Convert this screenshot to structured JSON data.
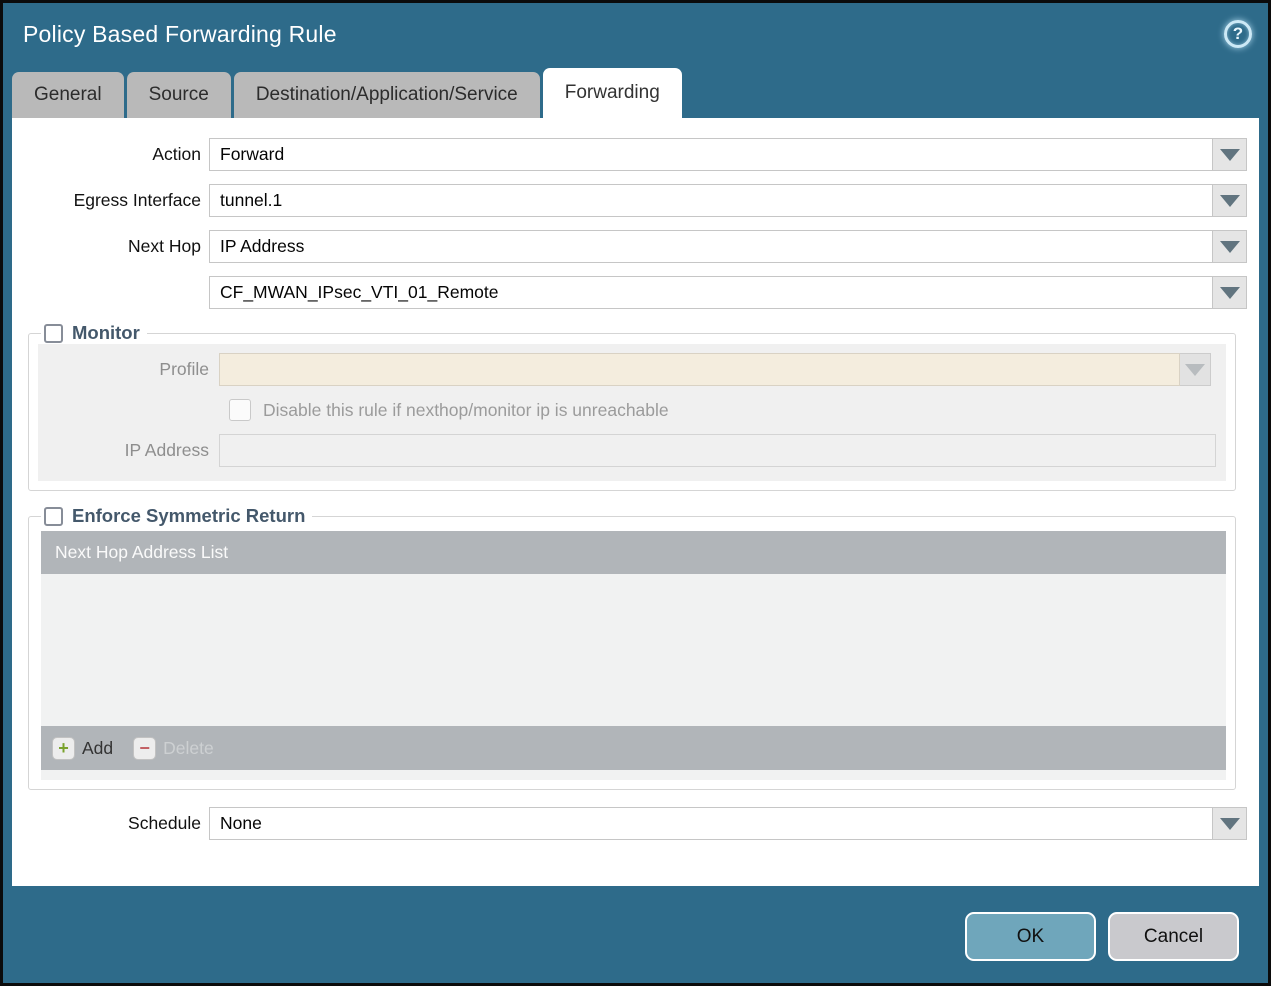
{
  "dialog": {
    "title": "Policy Based Forwarding Rule"
  },
  "tabs": [
    {
      "label": "General",
      "active": false
    },
    {
      "label": "Source",
      "active": false
    },
    {
      "label": "Destination/Application/Service",
      "active": false
    },
    {
      "label": "Forwarding",
      "active": true
    }
  ],
  "form": {
    "action": {
      "label": "Action",
      "value": "Forward"
    },
    "egress_interface": {
      "label": "Egress Interface",
      "value": "tunnel.1"
    },
    "next_hop": {
      "label": "Next Hop",
      "value": "IP Address"
    },
    "next_hop_address": {
      "value": "CF_MWAN_IPsec_VTI_01_Remote"
    },
    "schedule": {
      "label": "Schedule",
      "value": "None"
    }
  },
  "monitor": {
    "legend": "Monitor",
    "checked": false,
    "profile": {
      "label": "Profile",
      "value": ""
    },
    "disable_rule": {
      "label": "Disable this rule if nexthop/monitor ip is unreachable",
      "checked": false
    },
    "ip_address": {
      "label": "IP Address",
      "value": ""
    }
  },
  "symmetric_return": {
    "legend": "Enforce Symmetric Return",
    "checked": false,
    "table": {
      "header": "Next Hop Address List",
      "rows": [],
      "add_label": "Add",
      "delete_label": "Delete"
    }
  },
  "footer": {
    "ok_label": "OK",
    "cancel_label": "Cancel"
  },
  "icons": {
    "help": "?",
    "add": "+",
    "delete": "−"
  },
  "colors": {
    "frame_teal": "#2e6b8a",
    "tab_inactive": "#b9b9b9",
    "legend_text": "#44586b",
    "profile_disabled_bg": "#f4edde",
    "table_header_bg": "#b1b5b9",
    "ok_button_bg": "#6fa6bb",
    "cancel_button_bg": "#c9c9cd"
  }
}
